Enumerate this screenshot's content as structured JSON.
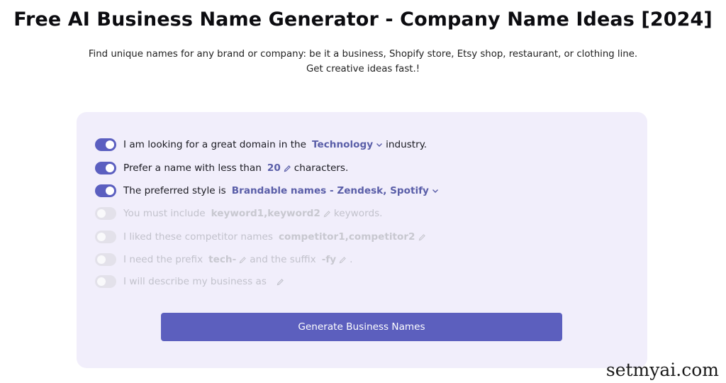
{
  "header": {
    "title": "Free AI Business Name Generator - Company Name Ideas [2024]",
    "subtitle_line1": "Find unique names for any brand or company: be it a business, Shopify store, Etsy shop, restaurant, or clothing line.",
    "subtitle_line2": "Get creative ideas fast.!"
  },
  "options": {
    "industry": {
      "enabled": true,
      "before": "I am looking for a great domain in the",
      "value": "Technology",
      "after": "industry."
    },
    "length": {
      "enabled": true,
      "before": "Prefer a name with less than",
      "value": "20",
      "after": "characters."
    },
    "style": {
      "enabled": true,
      "before": "The preferred style is",
      "value": "Brandable names - Zendesk, Spotify"
    },
    "keywords": {
      "enabled": false,
      "before": "You must include",
      "value": "keyword1,keyword2",
      "after": "keywords."
    },
    "competitors": {
      "enabled": false,
      "before": "I liked these competitor names",
      "value": "competitor1,competitor2"
    },
    "affix": {
      "enabled": false,
      "before": "I need the prefix",
      "prefix": "tech-",
      "middle": "and the suffix",
      "suffix": "-fy",
      "after": "."
    },
    "description": {
      "enabled": false,
      "before": "I will describe my business as"
    }
  },
  "generate_button": {
    "label": "Generate Business Names"
  },
  "watermark": "setmyai.com",
  "colors": {
    "accent": "#5c5fbe",
    "panel_bg": "#f1eefb",
    "value_text": "#5a5ea8",
    "disabled_text": "#c2c2cc"
  }
}
